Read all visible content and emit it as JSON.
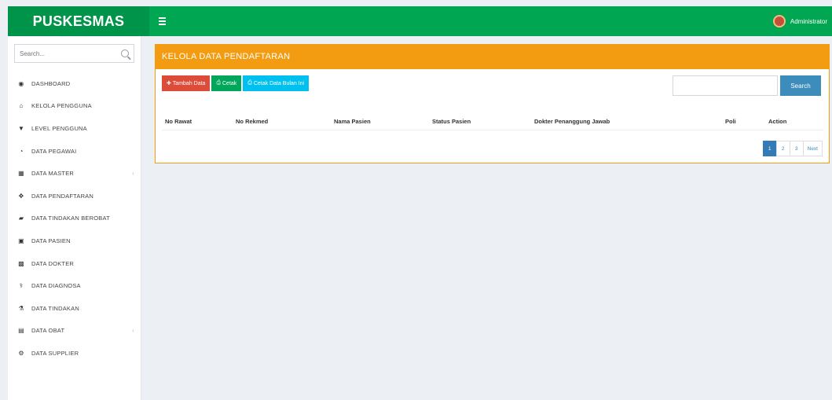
{
  "header": {
    "brand": "PUSKESMAS",
    "user_name": "Administrator"
  },
  "sidebar": {
    "search_placeholder": "Search...",
    "items": [
      {
        "label": "DASHBOARD",
        "icon": "dashboard-icon",
        "glyph": "◉"
      },
      {
        "label": "KELOLA PENGGUNA",
        "icon": "user-icon",
        "glyph": "⌂"
      },
      {
        "label": "LEVEL PENGGUNA",
        "icon": "level-icon",
        "glyph": "▼"
      },
      {
        "label": "DATA PEGAWAI",
        "icon": "employee-icon",
        "glyph": "◔"
      },
      {
        "label": "DATA MASTER",
        "icon": "grid-icon",
        "glyph": "▦",
        "has_children": true
      },
      {
        "label": "DATA PENDAFTARAN",
        "icon": "registration-icon",
        "glyph": "✥"
      },
      {
        "label": "DATA TINDAKAN BEROBAT",
        "icon": "treatment-icon",
        "glyph": "▰"
      },
      {
        "label": "DATA PASIEN",
        "icon": "patient-icon",
        "glyph": "▣"
      },
      {
        "label": "DATA DOKTER",
        "icon": "doctor-icon",
        "glyph": "▩"
      },
      {
        "label": "DATA DIAGNOSA",
        "icon": "diagnosis-icon",
        "glyph": "⚕"
      },
      {
        "label": "DATA TINDAKAN",
        "icon": "action-icon",
        "glyph": "⚗"
      },
      {
        "label": "DATA OBAT",
        "icon": "medicine-icon",
        "glyph": "▤",
        "has_children": true
      },
      {
        "label": "DATA SUPPLIER",
        "icon": "supplier-icon",
        "glyph": "⚙"
      }
    ]
  },
  "panel": {
    "title": "KELOLA DATA PENDAFTARAN",
    "buttons": {
      "add": "Tambah Data",
      "print": "Cetak",
      "print_report": "Cetak Data Bulan Ini"
    },
    "search_button": "Search",
    "columns": [
      "No Rawat",
      "No Rekmed",
      "Nama Pasien",
      "Status Pasien",
      "Dokter Penanggung Jawab",
      "Poli",
      "Action"
    ],
    "pagination": [
      "1",
      "2",
      "3",
      "Next"
    ]
  },
  "colors": {
    "topbar": "#00a651",
    "panel_header": "#f39c12",
    "primary": "#3c8dbc"
  }
}
